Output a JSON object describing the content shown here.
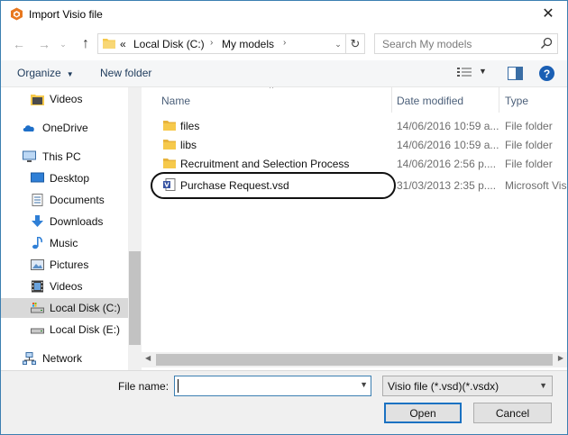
{
  "window": {
    "title": "Import Visio file",
    "close": "✕"
  },
  "nav": {
    "back": "←",
    "forward": "→",
    "recent": "⌄",
    "up": "↑",
    "address_prefix": "«",
    "address_segments": [
      "Local Disk (C:)",
      "My models"
    ],
    "address_sep": "›",
    "refresh": "↻",
    "search_placeholder": "Search My models"
  },
  "toolbar": {
    "organize": "Organize",
    "new_folder": "New folder",
    "help": "?"
  },
  "sidebar": {
    "items": [
      {
        "label": "Videos",
        "icon": "folder-video-icon"
      },
      {
        "label": "OneDrive",
        "icon": "cloud-icon"
      },
      {
        "label": "This PC",
        "icon": "computer-icon"
      },
      {
        "label": "Desktop",
        "icon": "desktop-icon"
      },
      {
        "label": "Documents",
        "icon": "documents-icon"
      },
      {
        "label": "Downloads",
        "icon": "downloads-icon"
      },
      {
        "label": "Music",
        "icon": "music-icon"
      },
      {
        "label": "Pictures",
        "icon": "pictures-icon"
      },
      {
        "label": "Videos",
        "icon": "videos-icon"
      },
      {
        "label": "Local Disk (C:)",
        "icon": "drive-icon"
      },
      {
        "label": "Local Disk (E:)",
        "icon": "drive-icon"
      },
      {
        "label": "Network",
        "icon": "network-icon"
      }
    ]
  },
  "columns": {
    "name": "Name",
    "date": "Date modified",
    "type": "Type"
  },
  "files": [
    {
      "name": "files",
      "date": "14/06/2016 10:59 a...",
      "type": "File folder",
      "icon": "folder-icon"
    },
    {
      "name": "libs",
      "date": "14/06/2016 10:59 a...",
      "type": "File folder",
      "icon": "folder-icon"
    },
    {
      "name": "Recruitment and Selection Process",
      "date": "14/06/2016 2:56 p....",
      "type": "File folder",
      "icon": "folder-icon"
    },
    {
      "name": "Purchase Request.vsd",
      "date": "31/03/2013 2:35 p....",
      "type": "Microsoft Visi",
      "icon": "visio-file-icon"
    }
  ],
  "footer": {
    "file_name_label": "File name:",
    "file_name_value": "",
    "file_type": "Visio file (*.vsd)(*.vsdx)",
    "open": "Open",
    "cancel": "Cancel"
  },
  "colors": {
    "accent": "#1a5fb4",
    "folder": "#f6c94b",
    "selection": "#d9d9d9"
  }
}
